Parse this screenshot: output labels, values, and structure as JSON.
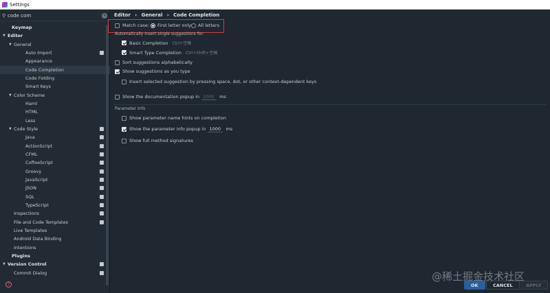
{
  "window": {
    "title": "Settings"
  },
  "search": {
    "value": "code com"
  },
  "tree": [
    {
      "label": "Keymap",
      "level": 0,
      "bold": true,
      "arrow": ""
    },
    {
      "label": "Editor",
      "level": 0,
      "bold": true,
      "arrow": "▼"
    },
    {
      "label": "General",
      "level": 1,
      "arrow": "▼"
    },
    {
      "label": "Auto Import",
      "level": 2,
      "badge": true
    },
    {
      "label": "Appearance",
      "level": 2
    },
    {
      "label": "Code Completion",
      "level": 2,
      "selected": true
    },
    {
      "label": "Code Folding",
      "level": 2
    },
    {
      "label": "Smart Keys",
      "level": 2
    },
    {
      "label": "Color Scheme",
      "level": 1,
      "arrow": "▼"
    },
    {
      "label": "Haml",
      "level": 2
    },
    {
      "label": "HTML",
      "level": 2
    },
    {
      "label": "Less",
      "level": 2
    },
    {
      "label": "Code Style",
      "level": 1,
      "arrow": "▼",
      "badge": true
    },
    {
      "label": "Java",
      "level": 2,
      "badge": true
    },
    {
      "label": "ActionScript",
      "level": 2,
      "badge": true
    },
    {
      "label": "CFML",
      "level": 2,
      "badge": true
    },
    {
      "label": "CoffeeScript",
      "level": 2,
      "badge": true
    },
    {
      "label": "Groovy",
      "level": 2,
      "badge": true
    },
    {
      "label": "JavaScript",
      "level": 2,
      "badge": true
    },
    {
      "label": "JSON",
      "level": 2,
      "badge": true
    },
    {
      "label": "SQL",
      "level": 2,
      "badge": true
    },
    {
      "label": "TypeScript",
      "level": 2,
      "badge": true
    },
    {
      "label": "Inspections",
      "level": 1,
      "badge": true
    },
    {
      "label": "File and Code Templates",
      "level": 1,
      "badge": true
    },
    {
      "label": "Live Templates",
      "level": 1
    },
    {
      "label": "Android Data Binding",
      "level": 1
    },
    {
      "label": "Intentions",
      "level": 1
    },
    {
      "label": "Plugins",
      "level": 0,
      "bold": true
    },
    {
      "label": "Version Control",
      "level": 0,
      "bold": true,
      "arrow": "▼",
      "badge": true
    },
    {
      "label": "Commit Dialog",
      "level": 1,
      "badge": true
    }
  ],
  "breadcrumb": [
    "Editor",
    "General",
    "Code Completion"
  ],
  "settings": {
    "match_case": {
      "label": "Match case:",
      "checked": false
    },
    "first_letter": {
      "label": "First letter only",
      "selected": true
    },
    "all_letters": {
      "label": "All letters",
      "selected": false
    },
    "auto_insert_header": "Automatically insert single suggestions for:",
    "basic_completion": {
      "label": "Basic Completion",
      "shortcut": "Ctrl+空格",
      "checked": true
    },
    "smart_type": {
      "label": "Smart Type Completion",
      "shortcut": "Ctrl+Shift+空格",
      "checked": true
    },
    "sort_alpha": {
      "label": "Sort suggestions alphabetically",
      "checked": false
    },
    "show_as_type": {
      "label": "Show suggestions as you type",
      "checked": true
    },
    "insert_selected": {
      "label": "Insert selected suggestion by pressing space, dot, or other context-dependent keys",
      "checked": false
    },
    "doc_popup": {
      "label": "Show the documentation popup in",
      "value": "1000",
      "unit": "ms",
      "checked": false
    },
    "param_info_header": "Parameter Info",
    "param_hints": {
      "label": "Show parameter name hints on completion",
      "checked": false
    },
    "param_popup": {
      "label": "Show the parameter info popup in",
      "value": "1000",
      "unit": "ms",
      "checked": true
    },
    "full_signatures": {
      "label": "Show full method signatures",
      "checked": false
    }
  },
  "buttons": {
    "ok": "OK",
    "cancel": "CANCEL",
    "apply": "APPLY"
  },
  "help_icon": "?",
  "watermark": "@稀土掘金技术社区"
}
